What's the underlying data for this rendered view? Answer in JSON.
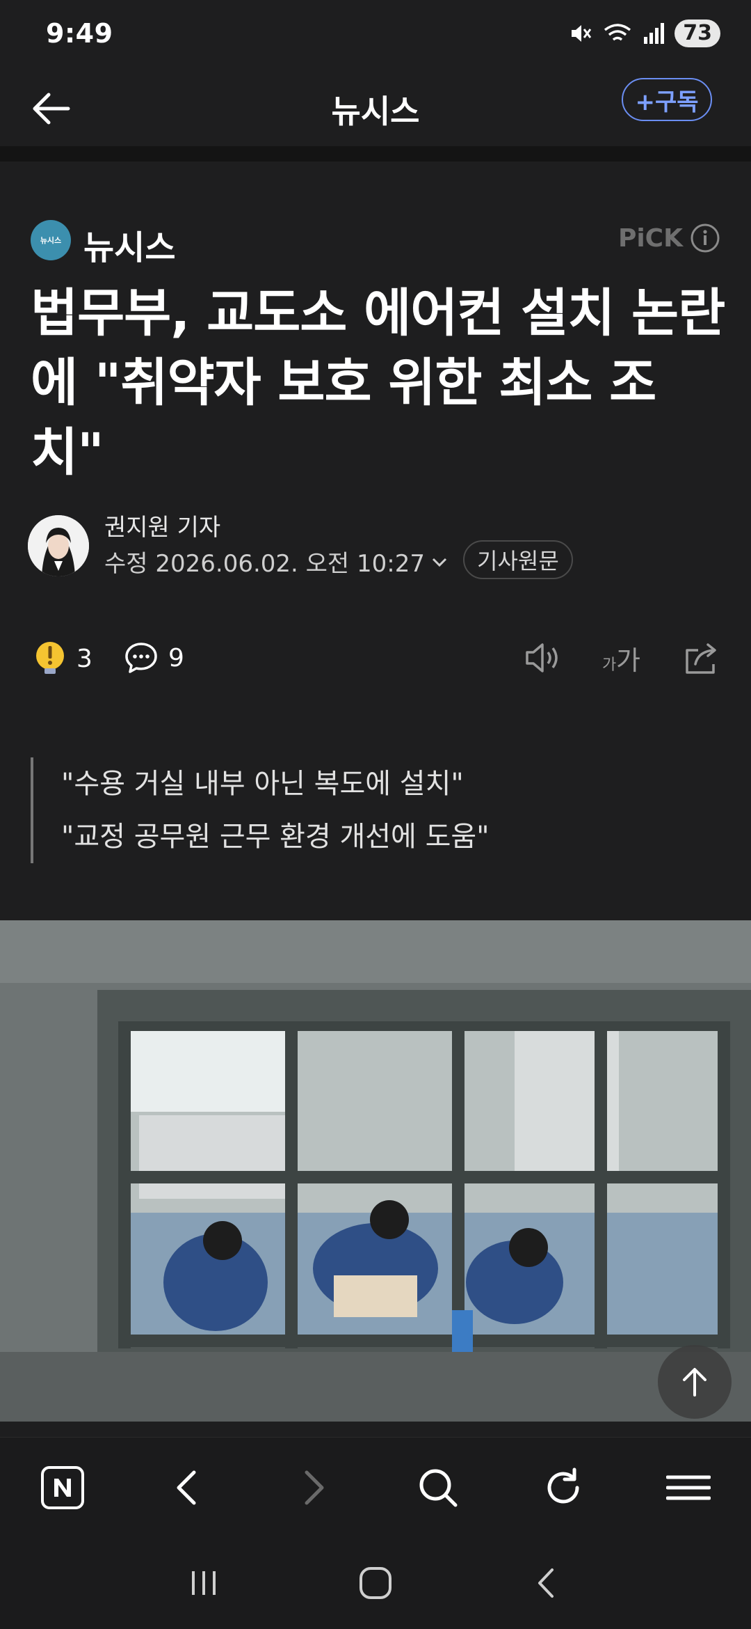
{
  "status_bar": {
    "time": "9:49",
    "battery": "73"
  },
  "header": {
    "title": "뉴시스",
    "subscribe_label": "+구독"
  },
  "press": {
    "logo_text": "뉴시스",
    "name": "뉴시스",
    "pick_label": "PiCK"
  },
  "article": {
    "title": "법무부, 교도소 에어컨 설치 논란에 \"취약자 보호 위한 최소 조치\"",
    "reporter": "권지원 기자",
    "edit_date": "수정 2026.06.02. 오전 10:27",
    "original_link": "기사원문",
    "reaction_count": "3",
    "comment_count": "9",
    "summary": [
      "\"수용 거실 내부 아닌 복도에 설치\"",
      "\"교정 공무원 근무 환경 개선에 도움\""
    ]
  },
  "icons": {
    "back": "arrow-left-icon",
    "info": "info-icon",
    "reaction": "exclamation-bulb-icon",
    "comment": "speech-bubble-icon",
    "speaker": "speaker-icon",
    "font_size": "font-size-icon",
    "share": "share-icon",
    "scroll_top": "arrow-up-icon"
  },
  "colors": {
    "background": "#1e1e1f",
    "accent": "#7da0ff",
    "reaction": "#f5c431"
  }
}
